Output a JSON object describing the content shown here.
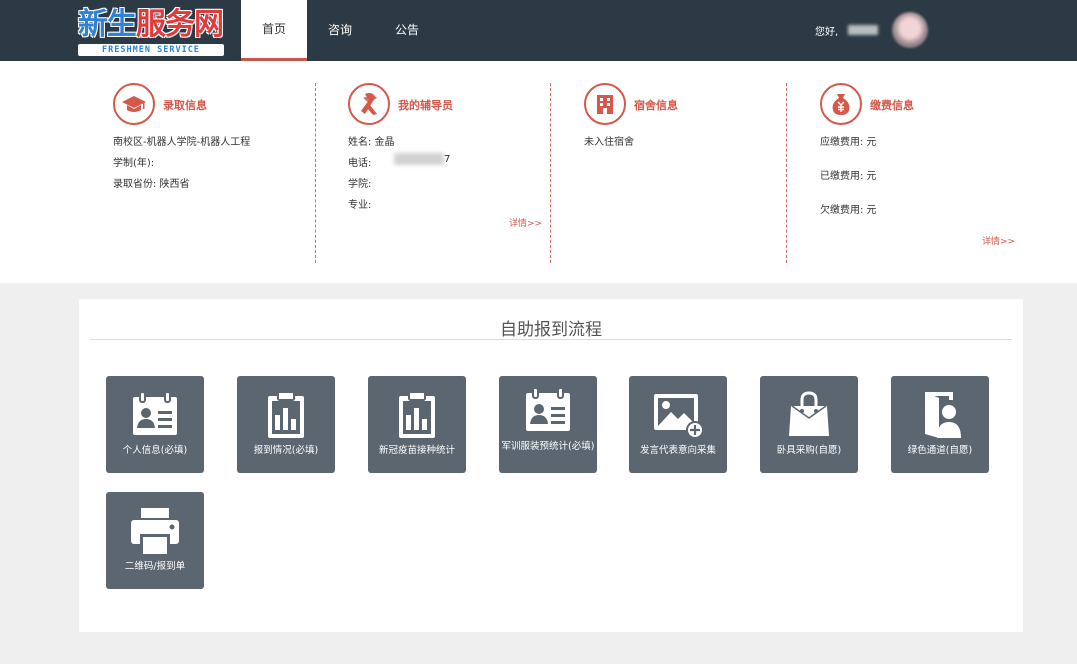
{
  "header": {
    "logo_main_a": "新生",
    "logo_main_b": "服务网",
    "logo_sub": "FRESHMEN SERVICE",
    "nav": [
      {
        "label": "首页",
        "active": true
      },
      {
        "label": "咨询",
        "active": false
      },
      {
        "label": "公告",
        "active": false
      }
    ],
    "greeting": "您好,"
  },
  "info": {
    "admission": {
      "icon": "graduation-cap-icon",
      "title": "录取信息",
      "lines": [
        "南校区-机器人学院-机器人工程",
        "学制(年):",
        "录取省份:  陕西省"
      ]
    },
    "counselor": {
      "icon": "ribbon-icon",
      "title": "我的辅导员",
      "lines": [
        "姓名:  金晶",
        "电话:",
        "学院:",
        "专业:"
      ],
      "phone_tail": "7",
      "detail": "详情>>"
    },
    "dorm": {
      "icon": "building-icon",
      "title": "宿舍信息",
      "lines": [
        "未入住宿舍"
      ]
    },
    "payment": {
      "icon": "money-bag-icon",
      "title": "缴费信息",
      "lines": [
        "应缴费用:  元",
        "已缴费用:  元",
        "欠缴费用:  元"
      ],
      "detail": "详情>>"
    }
  },
  "process": {
    "title": "自助报到流程",
    "tiles": [
      {
        "label": "个人信息(必填)",
        "icon": "id-card-icon"
      },
      {
        "label": "报到情况(必填)",
        "icon": "clipboard-chart-icon"
      },
      {
        "label": "新冠疫苗接种统计",
        "icon": "clipboard-chart-icon"
      },
      {
        "label": "军训服装预统计(必填)",
        "icon": "id-card-icon"
      },
      {
        "label": "发言代表意向采集",
        "icon": "image-add-icon"
      },
      {
        "label": "卧具采购(自愿)",
        "icon": "shopping-bag-icon"
      },
      {
        "label": "绿色通道(自愿)",
        "icon": "person-door-icon"
      },
      {
        "label": "二维码/报到单",
        "icon": "printer-icon"
      }
    ]
  },
  "colors": {
    "header_bg": "#2c3a45",
    "accent_red": "#d6584a",
    "tile_bg": "#5c6670",
    "page_bg": "#efefef"
  }
}
